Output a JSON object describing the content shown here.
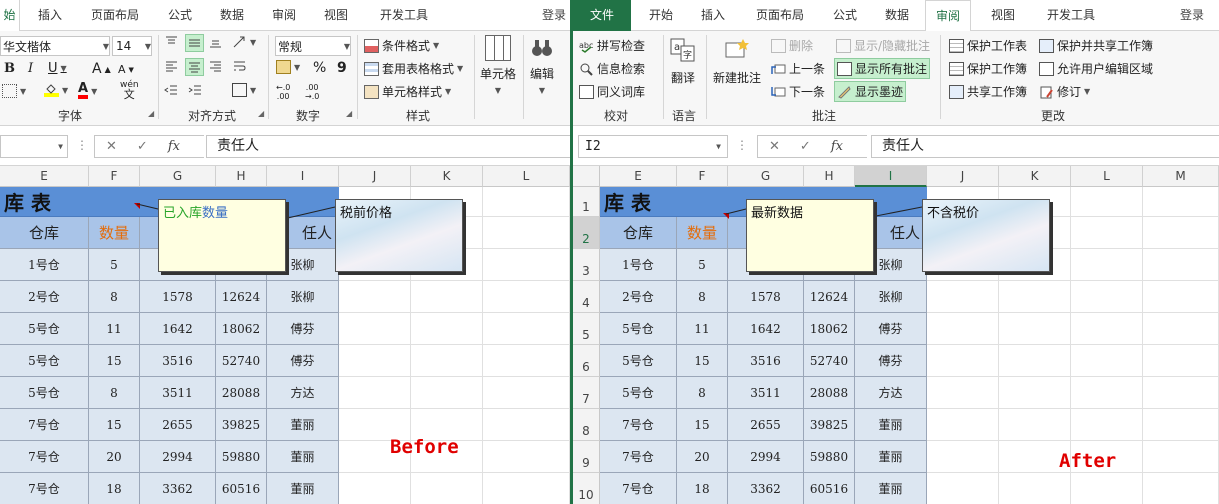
{
  "left": {
    "tabs": [
      "始",
      "插入",
      "页面布局",
      "公式",
      "数据",
      "审阅",
      "视图",
      "开发工具"
    ],
    "login": "登录",
    "ribbon": {
      "font_name": "华文楷体",
      "font_size": "14",
      "bold": "B",
      "italic": "I",
      "underline": "U",
      "grow_font": "A",
      "shrink_font": "A",
      "font_color_letter": "A",
      "phonetic_top": "wén",
      "phonetic_bottom": "文",
      "number_format": "常规",
      "percent": "%",
      "comma": "9",
      "inc_decimal_top": "←.0",
      "inc_decimal_bottom": ".00",
      "dec_decimal_top": ".00",
      "dec_decimal_bottom": "→.0",
      "cond_format": "条件格式",
      "table_format": "套用表格格式",
      "cell_styles": "单元格样式",
      "cells_btn": "单元格",
      "edit_btn": "编辑",
      "group_font": "字体",
      "group_align": "对齐方式",
      "group_number": "数字",
      "group_styles": "样式"
    },
    "formula": {
      "fx": "fx",
      "value": "责任人"
    },
    "columns": [
      "E",
      "F",
      "G",
      "H",
      "I",
      "J",
      "K",
      "L"
    ],
    "comment1": {
      "part_green": "已入库",
      "part_blue": "数量"
    },
    "comment2": "税前价格",
    "label": "Before"
  },
  "right": {
    "tabs": [
      "文件",
      "开始",
      "插入",
      "页面布局",
      "公式",
      "数据",
      "审阅",
      "视图",
      "开发工具"
    ],
    "login": "登录",
    "ribbon": {
      "spell": "拼写检查",
      "research": "信息检索",
      "thesaurus": "同义词库",
      "translate": "翻译",
      "new_comment": "新建批注",
      "delete": "删除",
      "prev": "上一条",
      "next": "下一条",
      "toggle_comment": "显示/隐藏批注",
      "show_all": "显示所有批注",
      "show_ink": "显示墨迹",
      "protect_sheet": "保护工作表",
      "protect_book": "保护工作簿",
      "share_book": "共享工作簿",
      "protect_share": "保护并共享工作簿",
      "allow_edit": "允许用户编辑区域",
      "track": "修订",
      "group_proof": "校对",
      "group_lang": "语言",
      "group_comment": "批注",
      "group_changes": "更改"
    },
    "formula": {
      "namebox": "I2",
      "fx": "fx",
      "value": "责任人"
    },
    "columns": [
      "E",
      "F",
      "G",
      "H",
      "I",
      "J",
      "K",
      "L",
      "M"
    ],
    "rows": [
      "1",
      "2",
      "3",
      "4",
      "5",
      "6",
      "7",
      "8",
      "9",
      "10"
    ],
    "comment1": "最新数据",
    "comment2": "不含税价",
    "label": "After"
  },
  "table": {
    "title": "库 表",
    "headers": [
      "仓库",
      "数量",
      "",
      "",
      "责任人"
    ],
    "header_visible": {
      "warehouse": "仓库",
      "qty": "数量",
      "owner_partial": "任人"
    },
    "rows": [
      [
        "1号仓",
        "5",
        "",
        "",
        "张柳"
      ],
      [
        "2号仓",
        "8",
        "1578",
        "12624",
        "张柳"
      ],
      [
        "5号仓",
        "11",
        "1642",
        "18062",
        "傅芬"
      ],
      [
        "5号仓",
        "15",
        "3516",
        "52740",
        "傅芬"
      ],
      [
        "5号仓",
        "8",
        "3511",
        "28088",
        "方达"
      ],
      [
        "7号仓",
        "15",
        "2655",
        "39825",
        "董丽"
      ],
      [
        "7号仓",
        "20",
        "2994",
        "59880",
        "董丽"
      ],
      [
        "7号仓",
        "18",
        "3362",
        "60516",
        "董丽"
      ]
    ]
  },
  "colors": {
    "excel_green": "#217346",
    "title_fill": "#5a8fd6",
    "header_fill": "#a9c4e8",
    "body_fill": "#dce6f1",
    "note_fill": "#ffffe1",
    "label_red": "#e00000"
  }
}
